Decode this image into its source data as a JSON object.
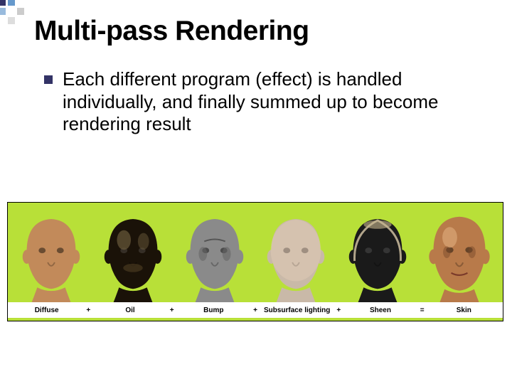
{
  "decoration": {
    "colors": [
      "#333366",
      "#6699cc",
      "#ffffff",
      "#99bbdd",
      "#ffffff",
      "#cccccc",
      "#ffffff",
      "#dddddd",
      "#ffffff"
    ]
  },
  "title": "Multi-pass Rendering",
  "bullet": "Each different program (effect) is handled individually, and finally summed up to become rendering result",
  "figure": {
    "passes": [
      {
        "label": "Diffuse",
        "fill": "#c28a5a",
        "tone": "flat",
        "scale": 1.0
      },
      {
        "label": "Oil",
        "fill": "#1a1208",
        "tone": "spec",
        "scale": 1.0
      },
      {
        "label": "Bump",
        "fill": "#8a8a8a",
        "tone": "bump",
        "scale": 1.0
      },
      {
        "label": "Subsurface lighting",
        "fill": "#c9b9a8",
        "tone": "sss",
        "scale": 1.0
      },
      {
        "label": "Sheen",
        "fill": "#1a1a1a",
        "tone": "rim",
        "scale": 1.0
      },
      {
        "label": "Skin",
        "fill": "#b87a4a",
        "tone": "full",
        "scale": 1.06
      }
    ],
    "operators": [
      "+",
      "+",
      "+",
      "+",
      "="
    ]
  }
}
